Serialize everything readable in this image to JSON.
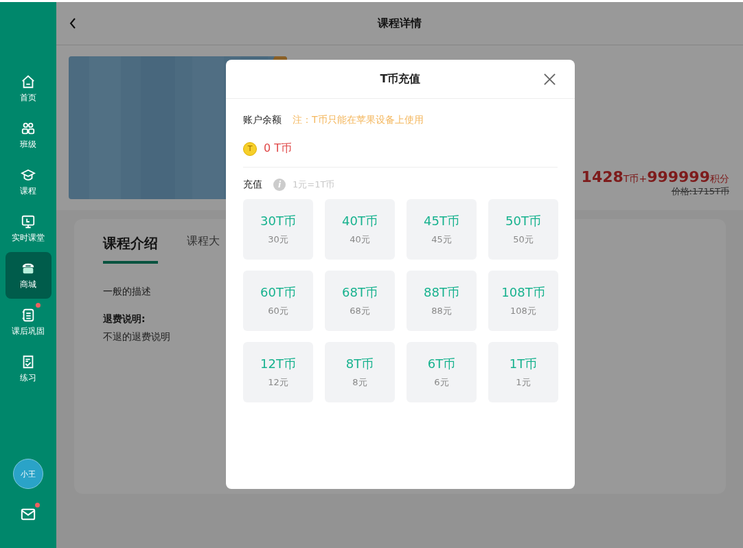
{
  "sidebar": {
    "items": [
      {
        "label": "首页",
        "selected": false,
        "badge": false
      },
      {
        "label": "班级",
        "selected": false,
        "badge": false
      },
      {
        "label": "课程",
        "selected": false,
        "badge": false
      },
      {
        "label": "实时课堂",
        "selected": false,
        "badge": false
      },
      {
        "label": "商城",
        "selected": true,
        "badge": false
      },
      {
        "label": "课后巩固",
        "selected": false,
        "badge": true
      },
      {
        "label": "练习",
        "selected": false,
        "badge": false
      }
    ],
    "avatar": "小王",
    "mail_badge": true
  },
  "header": {
    "title": "课程详情"
  },
  "course": {
    "price_parts": [
      {
        "text": "1428",
        "kind": "amount"
      },
      {
        "text": "T币",
        "kind": "unit"
      },
      {
        "text": "+",
        "kind": "unit"
      },
      {
        "text": "999999",
        "kind": "amount"
      },
      {
        "text": "积分",
        "kind": "unit"
      }
    ],
    "original_price": "价格:1715T币"
  },
  "tabs": [
    {
      "label": "课程介绍",
      "selected": true
    },
    {
      "label": "课程大",
      "selected": false
    }
  ],
  "description": "一般的描述",
  "refund_title": "退费说明:",
  "refund_text": "不退的退费说明",
  "dialog": {
    "title": "T币充值",
    "balance_label": "账户余额",
    "note": "注：T币只能在苹果设备上使用",
    "coin_symbol": "T",
    "balance": "0 T币",
    "recharge_label": "充值",
    "info_symbol": "i",
    "rate": "1元=1T币",
    "options": [
      {
        "coins": "30T币",
        "price": "30元"
      },
      {
        "coins": "40T币",
        "price": "40元"
      },
      {
        "coins": "45T币",
        "price": "45元"
      },
      {
        "coins": "50T币",
        "price": "50元"
      },
      {
        "coins": "60T币",
        "price": "60元"
      },
      {
        "coins": "68T币",
        "price": "68元"
      },
      {
        "coins": "88T币",
        "price": "88元"
      },
      {
        "coins": "108T币",
        "price": "108元"
      },
      {
        "coins": "12T币",
        "price": "12元"
      },
      {
        "coins": "8T币",
        "price": "8元"
      },
      {
        "coins": "6T币",
        "price": "6元"
      },
      {
        "coins": "1T币",
        "price": "1元"
      }
    ]
  }
}
